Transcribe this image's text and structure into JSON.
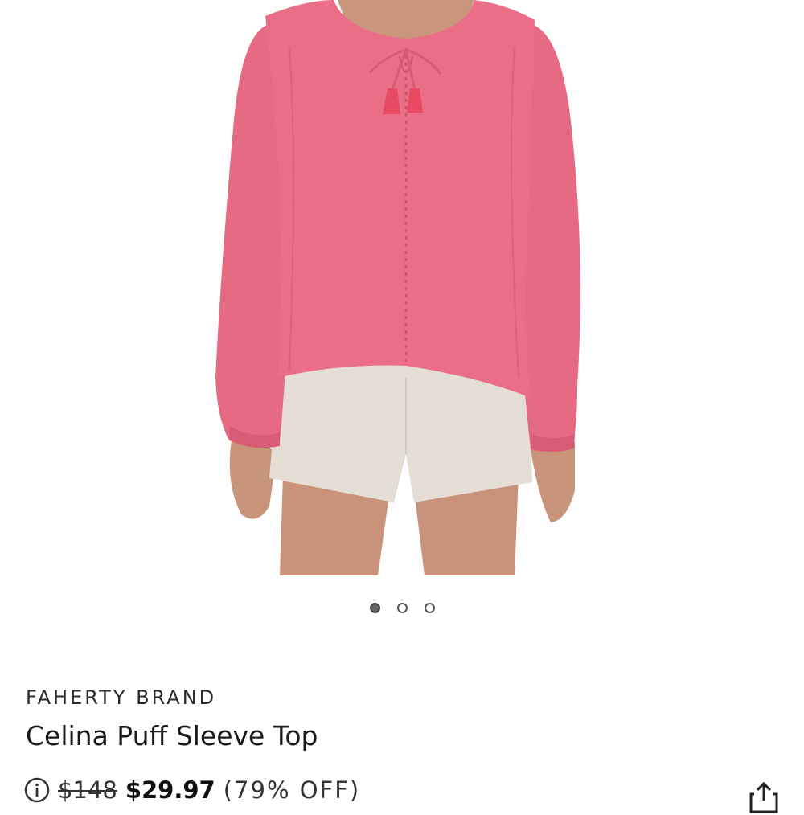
{
  "product": {
    "brand": "FAHERTY BRAND",
    "title": "Celina Puff Sleeve Top",
    "price_original": "$148",
    "price_sale": "$29.97",
    "discount": "(79% OFF)"
  },
  "gallery": {
    "image_count": 3,
    "active_index": 0
  },
  "icons": {
    "info": "info-icon",
    "share": "share-icon"
  },
  "colors": {
    "top": "#e8687f",
    "shorts": "#e2ddd4",
    "skin": "#c9957a",
    "text": "#1f1f1f"
  }
}
